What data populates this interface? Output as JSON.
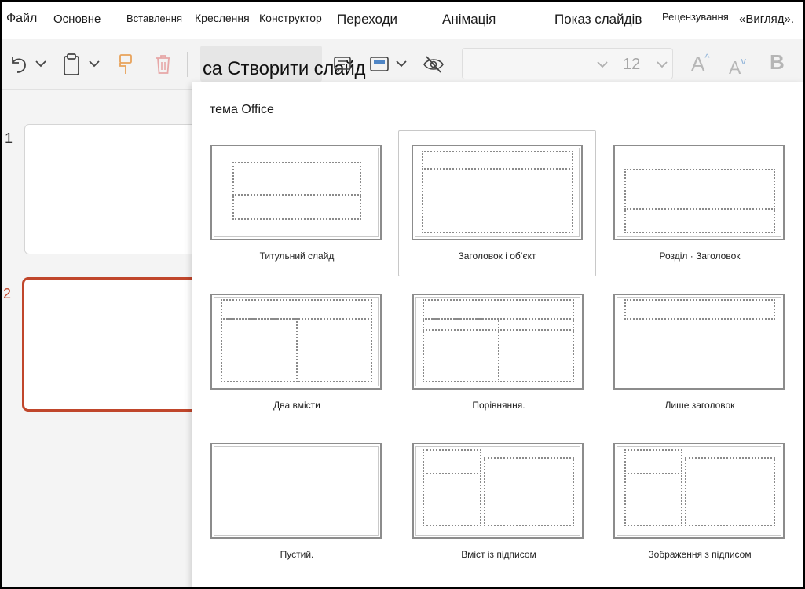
{
  "menu": {
    "items": [
      "Файл",
      "Основне",
      "Вставлення",
      "Креслення",
      "Конструктор",
      "Переходи",
      "Анімація",
      "Показ слайдів",
      "Рецензування",
      "«Вигляд»."
    ]
  },
  "toolbar": {
    "new_slide_label": "са Створити слайд",
    "font_size": "12",
    "grow_font": "A",
    "shrink_font": "A",
    "bold": "B"
  },
  "slides": {
    "numbers": [
      "1",
      "2"
    ],
    "selected": 2
  },
  "gallery": {
    "title": "тема Office",
    "layouts": [
      "Титульний слайд",
      "Заголовок і об’єкт",
      "Розділ · Заголовок",
      "Два вмісти",
      "Порівняння.",
      "Лише заголовок",
      "Пустий.",
      "Вміст із підписом",
      "Зображення з підписом"
    ]
  },
  "colors": {
    "selected_slide_border": "#c0462b",
    "toolbar_bg": "#f3f3f3",
    "pane_bg": "#f4f4f4"
  }
}
